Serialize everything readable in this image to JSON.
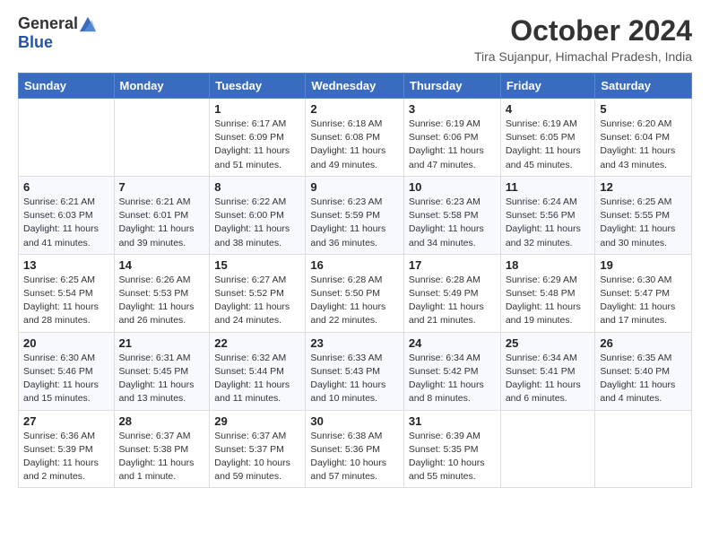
{
  "logo": {
    "general": "General",
    "blue": "Blue"
  },
  "header": {
    "month": "October 2024",
    "location": "Tira Sujanpur, Himachal Pradesh, India"
  },
  "weekdays": [
    "Sunday",
    "Monday",
    "Tuesday",
    "Wednesday",
    "Thursday",
    "Friday",
    "Saturday"
  ],
  "weeks": [
    [
      {
        "day": "",
        "info": ""
      },
      {
        "day": "",
        "info": ""
      },
      {
        "day": "1",
        "info": "Sunrise: 6:17 AM\nSunset: 6:09 PM\nDaylight: 11 hours and 51 minutes."
      },
      {
        "day": "2",
        "info": "Sunrise: 6:18 AM\nSunset: 6:08 PM\nDaylight: 11 hours and 49 minutes."
      },
      {
        "day": "3",
        "info": "Sunrise: 6:19 AM\nSunset: 6:06 PM\nDaylight: 11 hours and 47 minutes."
      },
      {
        "day": "4",
        "info": "Sunrise: 6:19 AM\nSunset: 6:05 PM\nDaylight: 11 hours and 45 minutes."
      },
      {
        "day": "5",
        "info": "Sunrise: 6:20 AM\nSunset: 6:04 PM\nDaylight: 11 hours and 43 minutes."
      }
    ],
    [
      {
        "day": "6",
        "info": "Sunrise: 6:21 AM\nSunset: 6:03 PM\nDaylight: 11 hours and 41 minutes."
      },
      {
        "day": "7",
        "info": "Sunrise: 6:21 AM\nSunset: 6:01 PM\nDaylight: 11 hours and 39 minutes."
      },
      {
        "day": "8",
        "info": "Sunrise: 6:22 AM\nSunset: 6:00 PM\nDaylight: 11 hours and 38 minutes."
      },
      {
        "day": "9",
        "info": "Sunrise: 6:23 AM\nSunset: 5:59 PM\nDaylight: 11 hours and 36 minutes."
      },
      {
        "day": "10",
        "info": "Sunrise: 6:23 AM\nSunset: 5:58 PM\nDaylight: 11 hours and 34 minutes."
      },
      {
        "day": "11",
        "info": "Sunrise: 6:24 AM\nSunset: 5:56 PM\nDaylight: 11 hours and 32 minutes."
      },
      {
        "day": "12",
        "info": "Sunrise: 6:25 AM\nSunset: 5:55 PM\nDaylight: 11 hours and 30 minutes."
      }
    ],
    [
      {
        "day": "13",
        "info": "Sunrise: 6:25 AM\nSunset: 5:54 PM\nDaylight: 11 hours and 28 minutes."
      },
      {
        "day": "14",
        "info": "Sunrise: 6:26 AM\nSunset: 5:53 PM\nDaylight: 11 hours and 26 minutes."
      },
      {
        "day": "15",
        "info": "Sunrise: 6:27 AM\nSunset: 5:52 PM\nDaylight: 11 hours and 24 minutes."
      },
      {
        "day": "16",
        "info": "Sunrise: 6:28 AM\nSunset: 5:50 PM\nDaylight: 11 hours and 22 minutes."
      },
      {
        "day": "17",
        "info": "Sunrise: 6:28 AM\nSunset: 5:49 PM\nDaylight: 11 hours and 21 minutes."
      },
      {
        "day": "18",
        "info": "Sunrise: 6:29 AM\nSunset: 5:48 PM\nDaylight: 11 hours and 19 minutes."
      },
      {
        "day": "19",
        "info": "Sunrise: 6:30 AM\nSunset: 5:47 PM\nDaylight: 11 hours and 17 minutes."
      }
    ],
    [
      {
        "day": "20",
        "info": "Sunrise: 6:30 AM\nSunset: 5:46 PM\nDaylight: 11 hours and 15 minutes."
      },
      {
        "day": "21",
        "info": "Sunrise: 6:31 AM\nSunset: 5:45 PM\nDaylight: 11 hours and 13 minutes."
      },
      {
        "day": "22",
        "info": "Sunrise: 6:32 AM\nSunset: 5:44 PM\nDaylight: 11 hours and 11 minutes."
      },
      {
        "day": "23",
        "info": "Sunrise: 6:33 AM\nSunset: 5:43 PM\nDaylight: 11 hours and 10 minutes."
      },
      {
        "day": "24",
        "info": "Sunrise: 6:34 AM\nSunset: 5:42 PM\nDaylight: 11 hours and 8 minutes."
      },
      {
        "day": "25",
        "info": "Sunrise: 6:34 AM\nSunset: 5:41 PM\nDaylight: 11 hours and 6 minutes."
      },
      {
        "day": "26",
        "info": "Sunrise: 6:35 AM\nSunset: 5:40 PM\nDaylight: 11 hours and 4 minutes."
      }
    ],
    [
      {
        "day": "27",
        "info": "Sunrise: 6:36 AM\nSunset: 5:39 PM\nDaylight: 11 hours and 2 minutes."
      },
      {
        "day": "28",
        "info": "Sunrise: 6:37 AM\nSunset: 5:38 PM\nDaylight: 11 hours and 1 minute."
      },
      {
        "day": "29",
        "info": "Sunrise: 6:37 AM\nSunset: 5:37 PM\nDaylight: 10 hours and 59 minutes."
      },
      {
        "day": "30",
        "info": "Sunrise: 6:38 AM\nSunset: 5:36 PM\nDaylight: 10 hours and 57 minutes."
      },
      {
        "day": "31",
        "info": "Sunrise: 6:39 AM\nSunset: 5:35 PM\nDaylight: 10 hours and 55 minutes."
      },
      {
        "day": "",
        "info": ""
      },
      {
        "day": "",
        "info": ""
      }
    ]
  ]
}
